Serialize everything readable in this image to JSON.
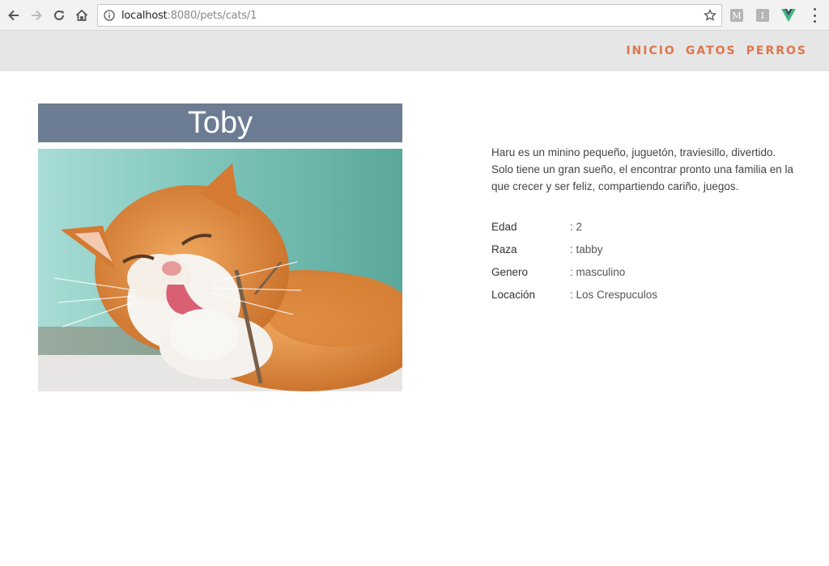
{
  "browser": {
    "url_host": "localhost",
    "url_path": ":8080/pets/cats/1",
    "extensions": [
      "M",
      "I"
    ]
  },
  "nav": {
    "items": [
      "INICIO",
      "GATOS",
      "PERROS"
    ],
    "accent_color": "#e0754a"
  },
  "pet": {
    "name": "Toby",
    "description": "Haru es un minino pequeño, juguetón, traviesillo, divertido. Solo tiene un gran sueño, el encontrar pronto una familia en la que crecer y ser feliz, compartiendo cariño, juegos.",
    "details": [
      {
        "label": "Edad",
        "value": ": 2"
      },
      {
        "label": "Raza",
        "value": ": tabby"
      },
      {
        "label": "Genero",
        "value": ": masculino"
      },
      {
        "label": "Locación",
        "value": ": Los Crespuculos"
      }
    ],
    "title_bg": "#6b7c93"
  }
}
